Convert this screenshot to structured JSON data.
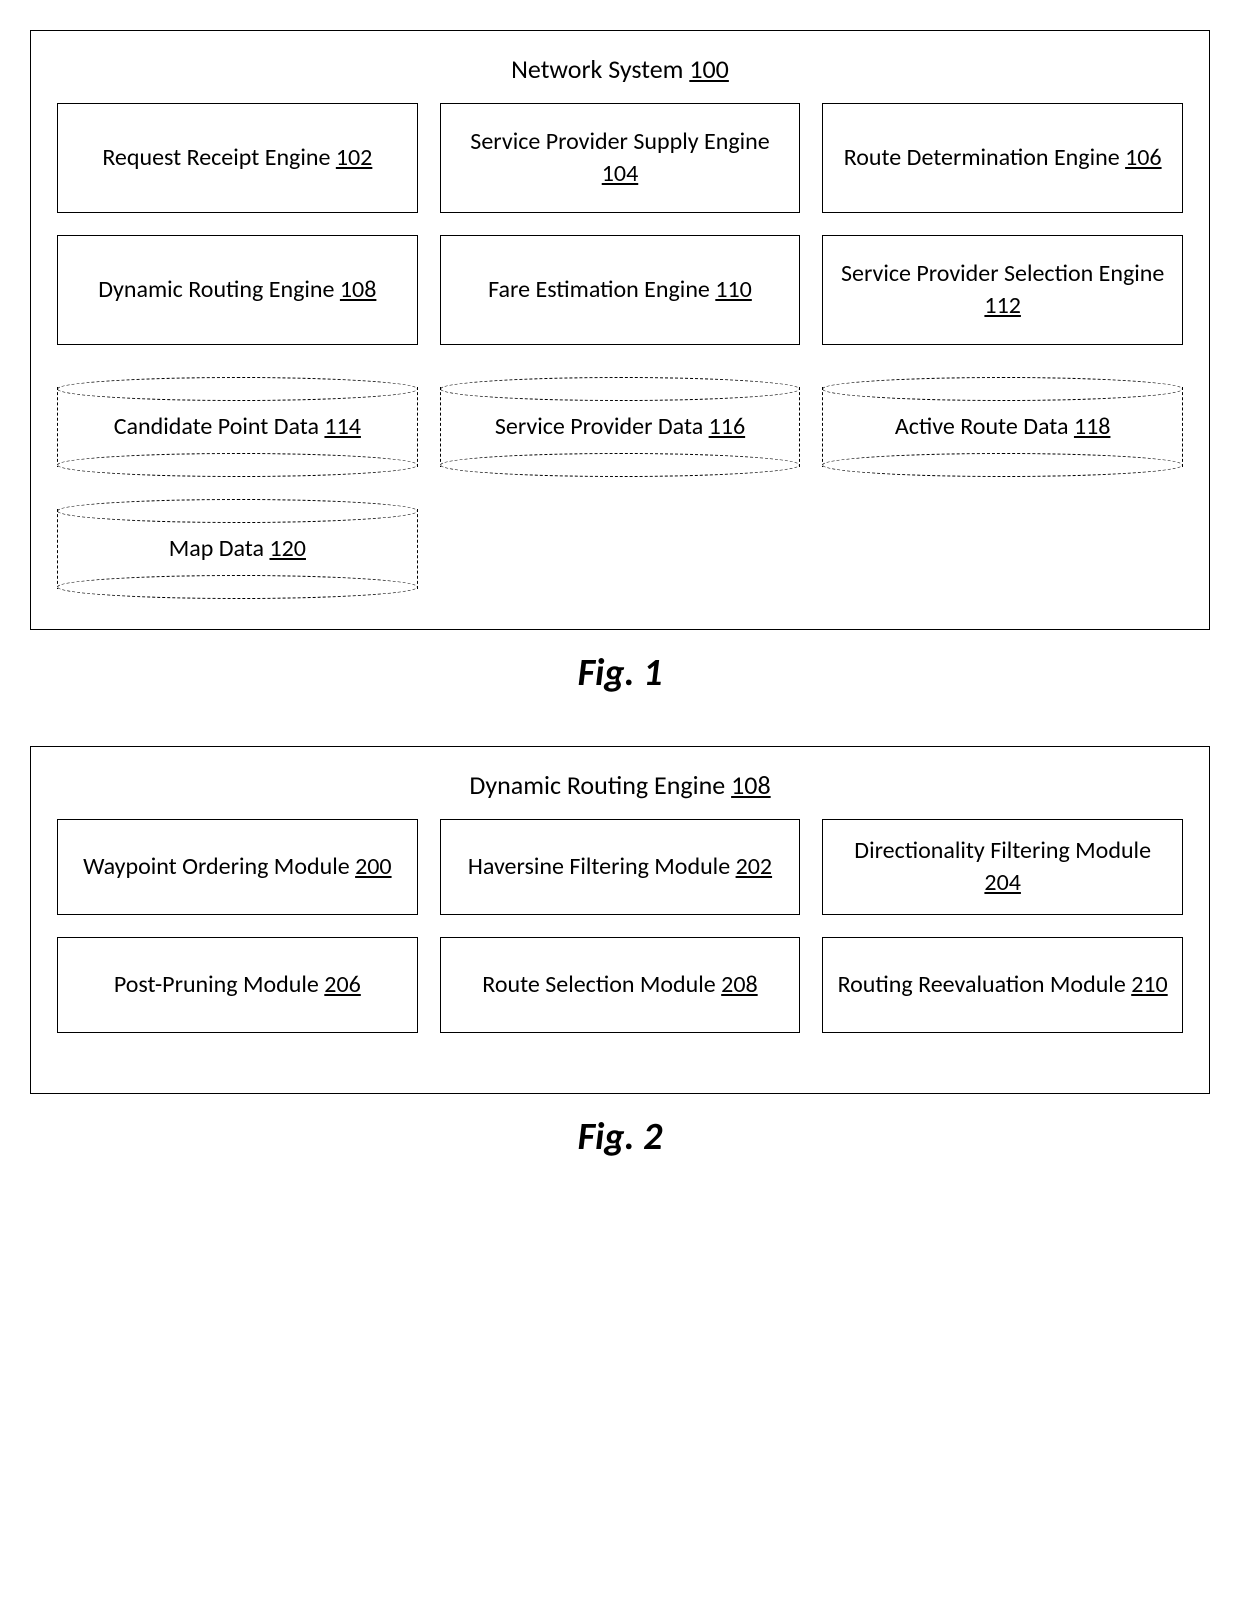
{
  "figure1": {
    "container": {
      "label": "Network System",
      "ref": "100"
    },
    "boxes": [
      {
        "label": "Request Receipt Engine",
        "ref": "102",
        "type": "rect"
      },
      {
        "label": "Service Provider Supply Engine",
        "ref": "104",
        "type": "rect"
      },
      {
        "label": "Route Determination Engine",
        "ref": "106",
        "type": "rect"
      },
      {
        "label": "Dynamic Routing Engine",
        "ref": "108",
        "type": "rect"
      },
      {
        "label": "Fare Estimation Engine",
        "ref": "110",
        "type": "rect"
      },
      {
        "label": "Service Provider Selection Engine",
        "ref": "112",
        "type": "rect"
      },
      {
        "label": "Candidate Point Data",
        "ref": "114",
        "type": "cylinder"
      },
      {
        "label": "Service Provider Data",
        "ref": "116",
        "type": "cylinder"
      },
      {
        "label": "Active Route Data",
        "ref": "118",
        "type": "cylinder"
      },
      {
        "label": "Map Data",
        "ref": "120",
        "type": "cylinder"
      }
    ],
    "caption": "Fig. 1"
  },
  "figure2": {
    "container": {
      "label": "Dynamic Routing Engine",
      "ref": "108"
    },
    "boxes": [
      {
        "label": "Waypoint Ordering Module",
        "ref": "200",
        "type": "rect"
      },
      {
        "label": "Haversine Filtering Module",
        "ref": "202",
        "type": "rect"
      },
      {
        "label": "Directionality Filtering Module",
        "ref": "204",
        "type": "rect"
      },
      {
        "label": "Post-Pruning Module",
        "ref": "206",
        "type": "rect"
      },
      {
        "label": "Route Selection Module",
        "ref": "208",
        "type": "rect"
      },
      {
        "label": "Routing Reevaluation Module",
        "ref": "210",
        "type": "rect"
      }
    ],
    "caption": "Fig. 2"
  }
}
